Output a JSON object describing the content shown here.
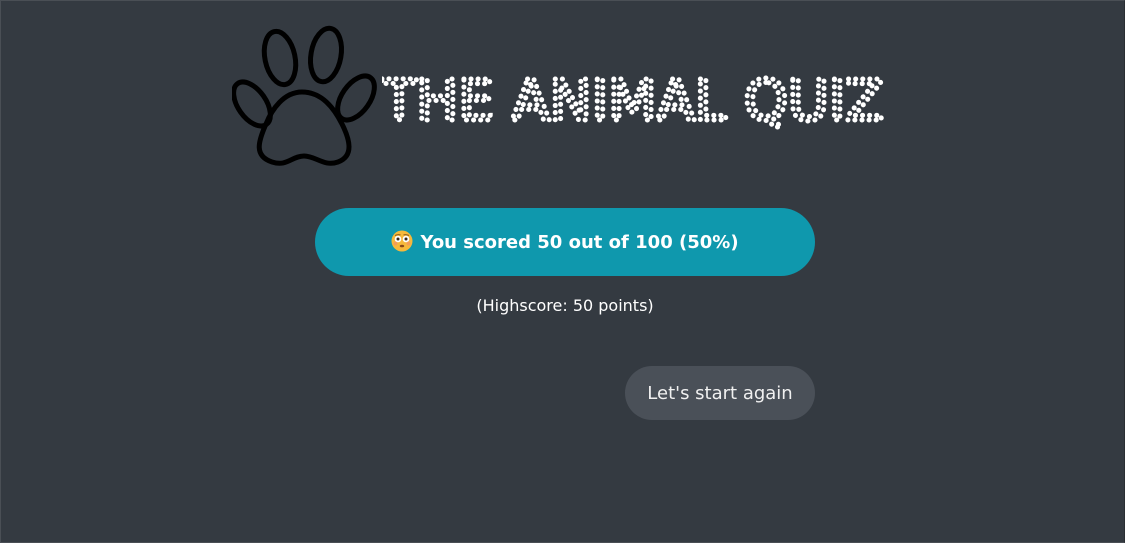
{
  "header": {
    "title": "THE ANIMAL QUIZ",
    "logo_icon": "paw-icon"
  },
  "result": {
    "emoji_icon": "flushed-face-icon",
    "prefix": "You scored",
    "score": "50",
    "middle": "out of",
    "total": "100",
    "percent": "(50%)"
  },
  "highscore_text": "(Highscore: 50 points)",
  "restart_label": "Let's start again",
  "colors": {
    "background": "#343a41",
    "accent": "#0f98ad",
    "secondary_button": "#4a5058"
  }
}
